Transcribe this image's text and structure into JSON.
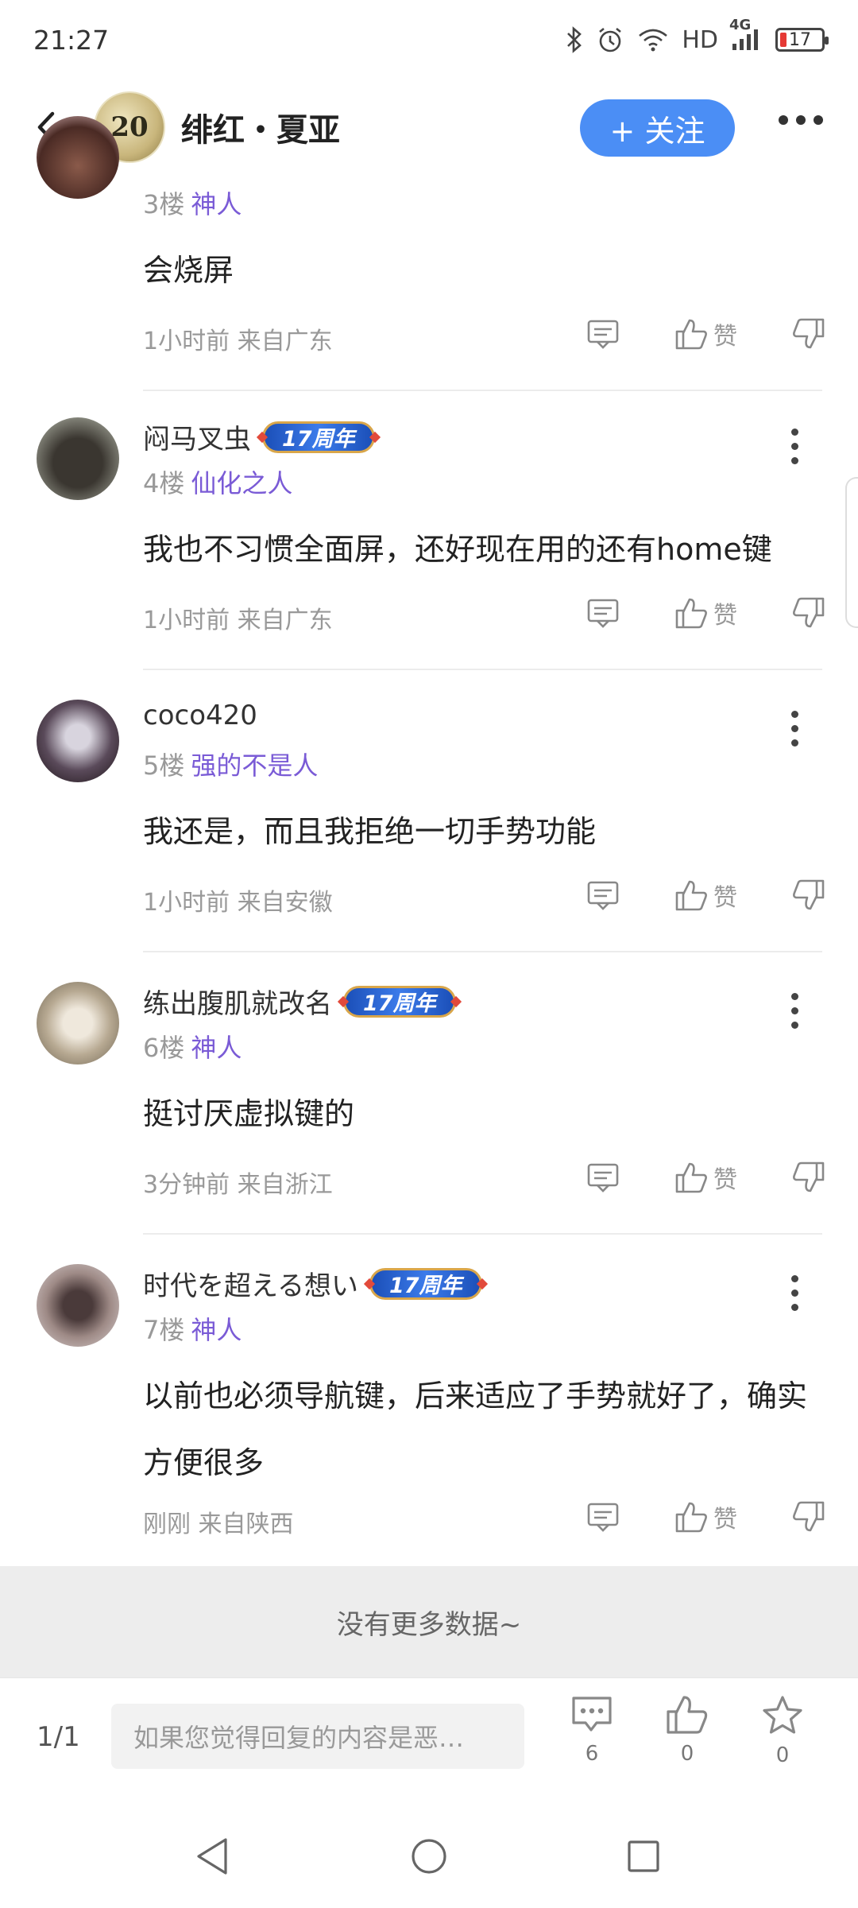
{
  "status_bar": {
    "time": "21:27",
    "network_label": "HD",
    "signal_label": "4G",
    "battery_level": "17",
    "icons": [
      "bluetooth-icon",
      "alarm-icon",
      "wifi-icon",
      "signal-icon",
      "battery-icon"
    ]
  },
  "header": {
    "forum_name": "绯红・夏亚",
    "forum_avatar_text": "20",
    "follow_label": "+ 关注",
    "icons": [
      "back-arrow-icon",
      "more-icon"
    ]
  },
  "posts": [
    {
      "username": "",
      "badge": "",
      "floor": "3楼",
      "level": "神人",
      "content": "会烧屏",
      "time": "1小时前",
      "location": "来自广东",
      "like_label": "赞"
    },
    {
      "username": "闷马叉虫",
      "badge": "17周年",
      "floor": "4楼",
      "level": "仙化之人",
      "content": "我也不习惯全面屏，还好现在用的还有home键",
      "time": "1小时前",
      "location": "来自广东",
      "like_label": "赞"
    },
    {
      "username": "coco420",
      "badge": "",
      "floor": "5楼",
      "level": "强的不是人",
      "content": "我还是，而且我拒绝一切手势功能",
      "time": "1小时前",
      "location": "来自安徽",
      "like_label": "赞"
    },
    {
      "username": "练出腹肌就改名",
      "badge": "17周年",
      "floor": "6楼",
      "level": "神人",
      "content": "挺讨厌虚拟键的",
      "time": "3分钟前",
      "location": "来自浙江",
      "like_label": "赞"
    },
    {
      "username": "时代を超える想い",
      "badge": "17周年",
      "floor": "7楼",
      "level": "神人",
      "content": "以前也必须导航键，后来适应了手势就好了，确实方便很多",
      "time": "刚刚",
      "location": "来自陕西",
      "like_label": "赞"
    }
  ],
  "footer": {
    "no_more_text": "没有更多数据~",
    "page_indicator": "1/1",
    "reply_placeholder": "如果您觉得回复的内容是恶…",
    "comment_count": "6",
    "like_count": "0",
    "favorite_count": "0"
  },
  "colors": {
    "accent_blue": "#4b8ef5",
    "level_purple": "#7a5bd6",
    "meta_gray": "#999999",
    "battery_red": "#e53935"
  }
}
